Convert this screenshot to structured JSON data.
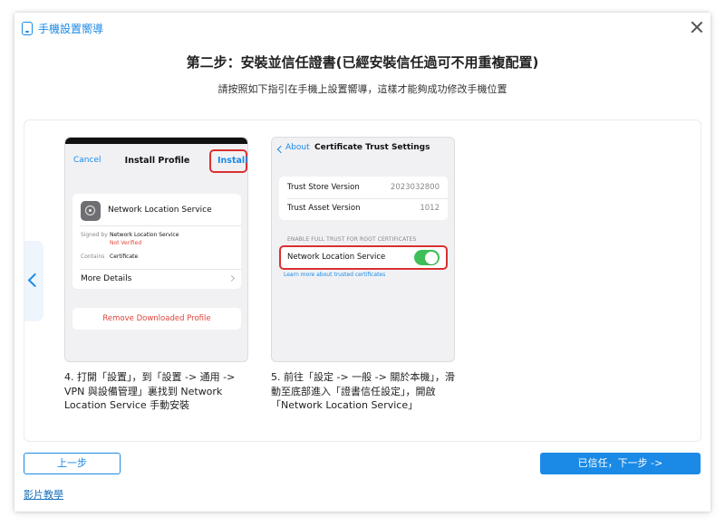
{
  "window": {
    "title": "手機設置嚮導",
    "icons": {
      "app": "phone-icon",
      "close": "close-icon"
    }
  },
  "header": {
    "heading": "第二步：安裝並信任證書(已經安裝信任過可不用重複配置)",
    "subheading": "請按照如下指引在手機上設置嚮導，這樣才能夠成功修改手機位置"
  },
  "steps": [
    {
      "screen": {
        "cancel": "Cancel",
        "title": "Install Profile",
        "install": "Install",
        "profile_name": "Network Location Service",
        "signed_by_label": "Signed by",
        "signed_by_value": "Network Location Service",
        "not_verified": "Not Verified",
        "contains_label": "Contains",
        "contains_value": "Certificate",
        "more_details": "More Details",
        "remove": "Remove Downloaded Profile"
      },
      "caption_lines": [
        "4. 打開「設置」，到「設置 -> 通用 ->",
        "VPN 與設備管理」裏找到 Network",
        "Location Service 手動安裝"
      ]
    },
    {
      "screen": {
        "back": "About",
        "title": "Certificate Trust Settings",
        "rows": [
          {
            "label": "Trust Store Version",
            "value": "2023032800"
          },
          {
            "label": "Trust Asset Version",
            "value": "1012"
          }
        ],
        "section": "ENABLE FULL TRUST FOR ROOT CERTIFICATES",
        "toggle_label": "Network Location Service",
        "toggle_on": true,
        "learn_more": "Learn more about trusted certificates"
      },
      "caption_lines": [
        "5. 前往「設定 -> 一般 -> 關於本機」，滑",
        "動至底部進入「證書信任設定」，開啟",
        "「Network Location Service」"
      ]
    }
  ],
  "footer": {
    "prev": "上一步",
    "next": "已信任，下一步 ->",
    "video": "影片教學"
  },
  "colors": {
    "accent": "#1a8ae6",
    "highlight": "#d93030",
    "toggle_on": "#3fbf5a",
    "danger_text": "#e0463c"
  }
}
